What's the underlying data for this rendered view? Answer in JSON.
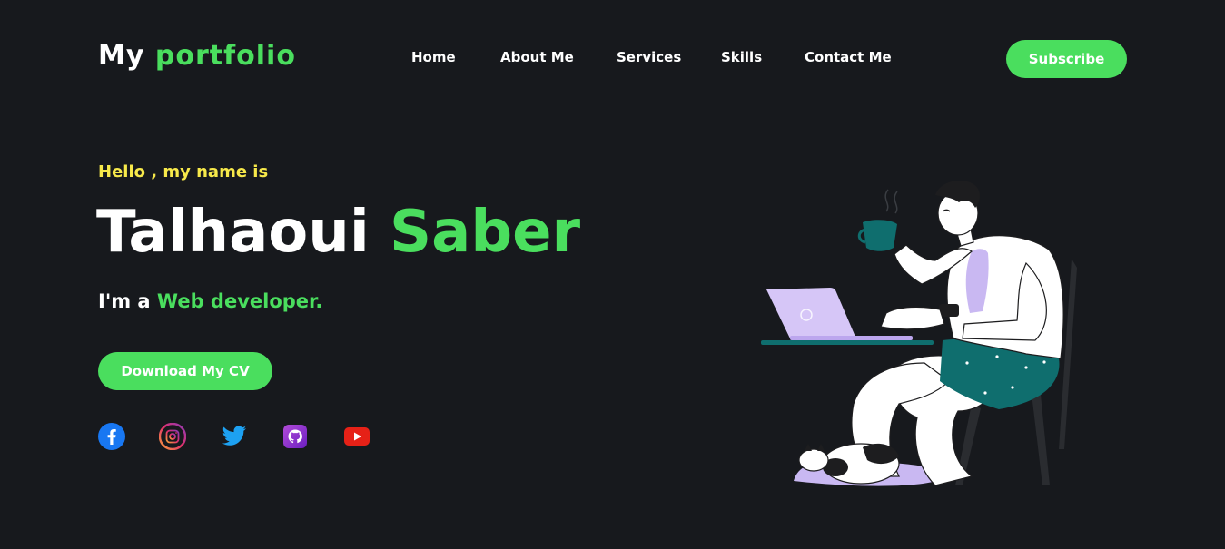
{
  "header": {
    "logo_prefix": "My",
    "logo_accent": "portfolio",
    "nav": [
      "Home",
      "About Me",
      "Services",
      "Skills",
      "Contact Me"
    ],
    "subscribe_label": "Subscribe"
  },
  "hero": {
    "greeting": "Hello , my name is",
    "first_name": "Talhaoui",
    "last_name": "Saber",
    "role_prefix": "I'm a",
    "role_accent": "Web developer.",
    "cv_label": "Download My CV"
  },
  "social": [
    "facebook-icon",
    "instagram-icon",
    "twitter-icon",
    "github-icon",
    "youtube-icon"
  ],
  "colors": {
    "background": "#17191d",
    "accent": "#4ade5e",
    "greeting": "#f7e94a",
    "text": "#ffffff"
  }
}
